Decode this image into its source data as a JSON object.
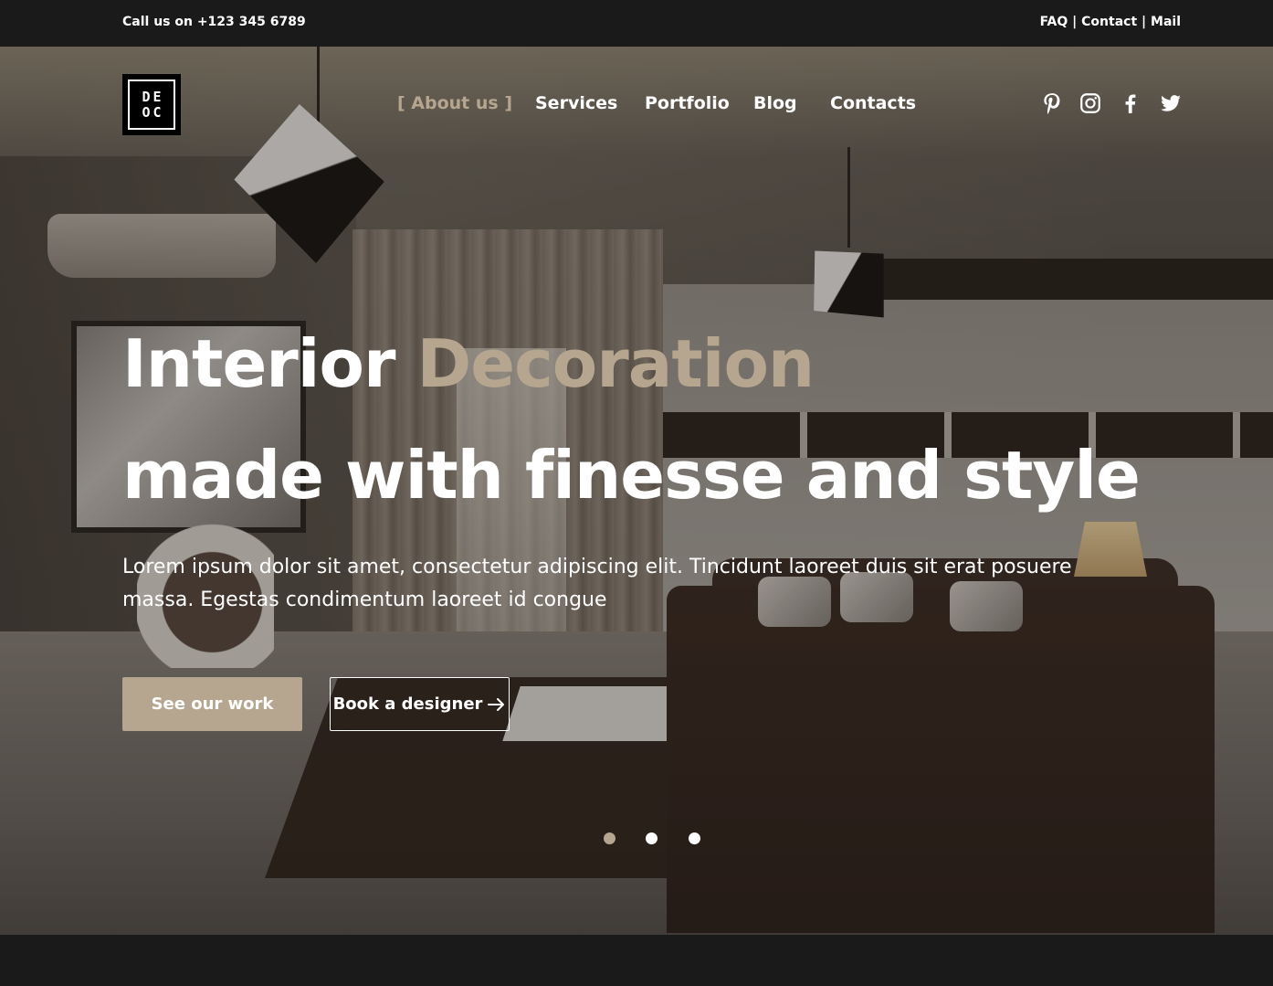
{
  "topbar": {
    "phone": "Call us on +123 345 6789",
    "links": [
      "FAQ",
      "Contact",
      "Mail"
    ],
    "separator": " | "
  },
  "logo": {
    "line1": "DE",
    "line2": "OC"
  },
  "nav": {
    "items": [
      "[ About us ]",
      "Services",
      "Portfolio",
      "Blog",
      "Contacts"
    ],
    "active_index": 0
  },
  "social": [
    {
      "name": "pinterest-icon"
    },
    {
      "name": "instagram-icon"
    },
    {
      "name": "facebook-icon"
    },
    {
      "name": "twitter-icon"
    }
  ],
  "hero": {
    "title_line1_plain": "Interior ",
    "title_line1_accent": "Decoration",
    "title_line2": "made with finesse and style",
    "description": "Lorem ipsum dolor sit amet, consectetur adipiscing elit. Tincidunt laoreet duis sit erat posuere massa. Egestas condimentum laoreet id congue",
    "primary_button": "See our work",
    "secondary_button": "Book a designer"
  },
  "carousel": {
    "slide_count": 3,
    "active_index": 0
  },
  "colors": {
    "accent": "#b6a68f",
    "dark": "#1a1a1a",
    "text": "#ffffff"
  }
}
